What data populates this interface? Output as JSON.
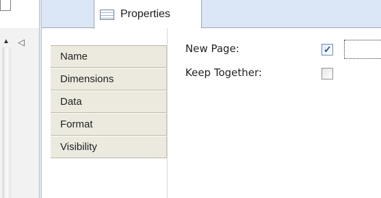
{
  "tabs": {
    "active_label": "Properties"
  },
  "categories": [
    {
      "label": "Name"
    },
    {
      "label": "Dimensions"
    },
    {
      "label": "Data"
    },
    {
      "label": "Format"
    },
    {
      "label": "Visibility"
    }
  ],
  "fields": {
    "new_page": {
      "label": "New Page:",
      "checked": true
    },
    "keep_together": {
      "label": "Keep Together:",
      "checked": false
    }
  },
  "icons": {
    "tab": "properties-sheet-icon",
    "scroll_up": "scroll-up-arrow-icon",
    "collapse": "collapse-left-arrow-icon"
  }
}
